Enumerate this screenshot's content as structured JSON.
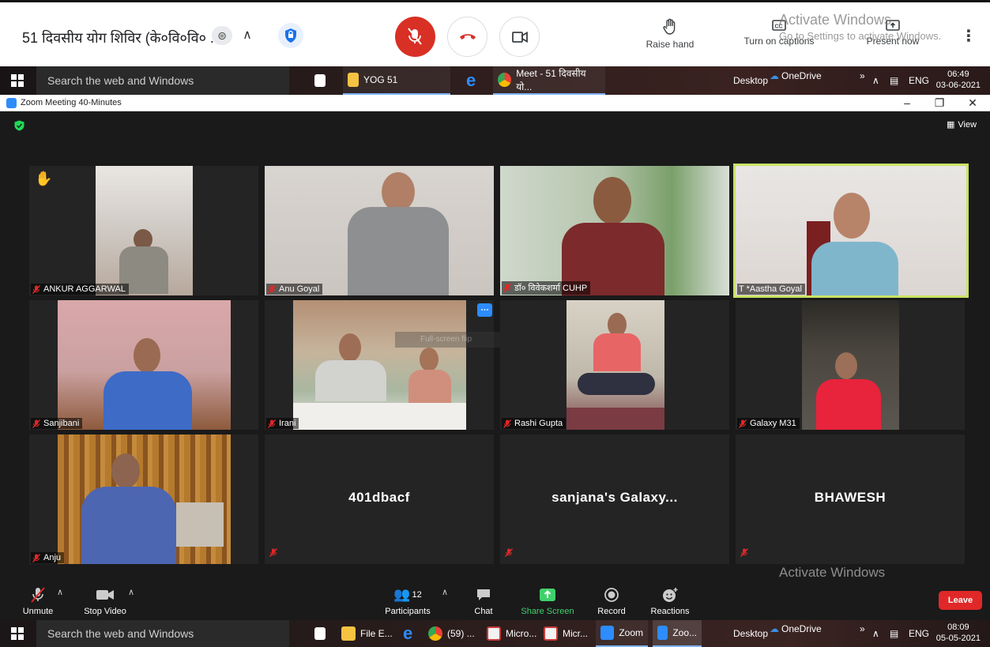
{
  "meet": {
    "title": "51 दिवसीय योग शिविर (के०वि०वि० ...",
    "raise_hand": "Raise hand",
    "captions": "Turn on captions",
    "present": "Present now"
  },
  "activate_windows": {
    "line1": "Activate Windows",
    "line2": "Go to Settings to activate Windows."
  },
  "taskbar_top": {
    "search": "Search the web and Windows",
    "items": [
      "YOG 51",
      "Meet - 51 दिवसीय यो..."
    ],
    "desktop": "Desktop",
    "onedrive": "OneDrive",
    "chevron": "»",
    "lang": "ENG",
    "time": "06:49",
    "date": "03-06-2021"
  },
  "zoom": {
    "window_title": "Zoom Meeting 40-Minutes",
    "view_label": "View",
    "tiles": [
      {
        "name": "ANKUR AGGARWAL"
      },
      {
        "name": "Anu Goyal"
      },
      {
        "name": "डॉ० विवेकशर्मा CUHP"
      },
      {
        "name": "T *Aastha Goyal"
      },
      {
        "name": "Sanjibani"
      },
      {
        "name": "Irani"
      },
      {
        "name": "Rashi Gupta"
      },
      {
        "name": "Galaxy M31"
      },
      {
        "name": "Anju"
      },
      {
        "name": "401dbacf"
      },
      {
        "name": "sanjana's  Galaxy..."
      },
      {
        "name": "BHAWESH"
      }
    ],
    "overlay_text": "Full-screen flip",
    "toolbar": {
      "unmute": "Unmute",
      "stop_video": "Stop Video",
      "participants": "Participants",
      "participants_count": "12",
      "chat": "Chat",
      "share_screen": "Share Screen",
      "record": "Record",
      "reactions": "Reactions",
      "leave": "Leave"
    }
  },
  "taskbar_bottom": {
    "search": "Search the web and Windows",
    "items": [
      "File E...",
      "(59) ...",
      "Micro...",
      "Micr...",
      "Zoom",
      "Zoo..."
    ],
    "desktop": "Desktop",
    "onedrive": "OneDrive",
    "chevron": "»",
    "lang": "ENG",
    "time": "08:09",
    "date": "05-05-2021"
  },
  "colors": {
    "meet_red": "#d93025",
    "zoom_blue": "#2d8cff",
    "mute_red": "#e02828",
    "share_green": "#3fd16b",
    "active_speaker": "#c9e265"
  }
}
